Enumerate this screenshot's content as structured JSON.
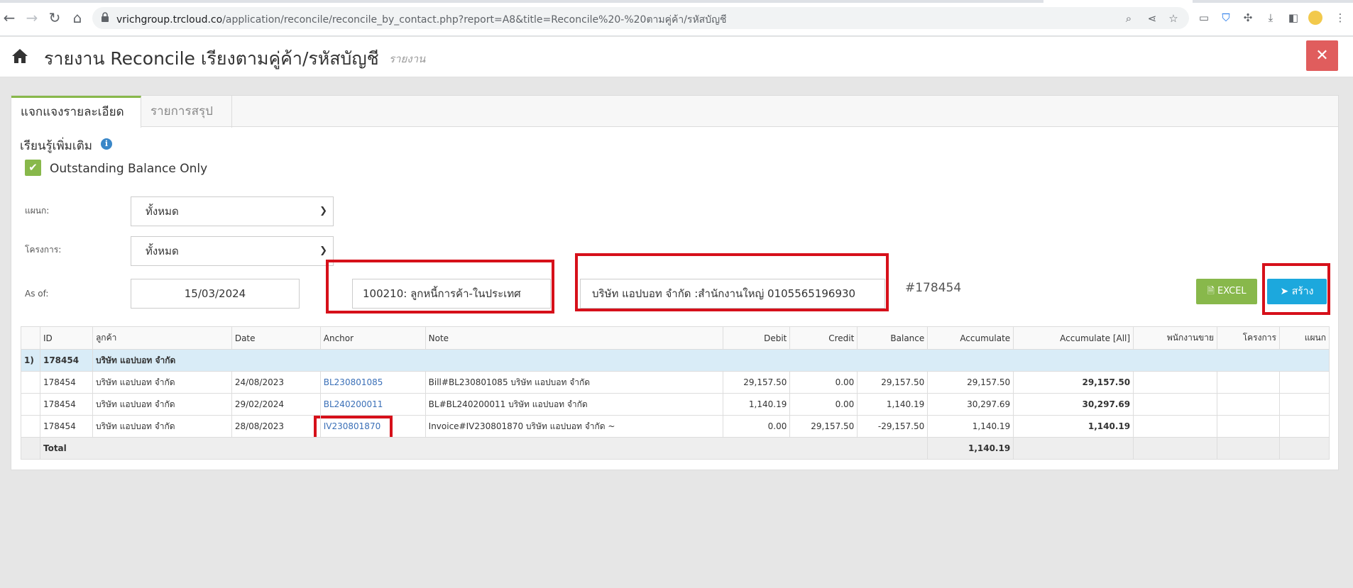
{
  "browser": {
    "url_host": "vrichgroup.trcloud.co",
    "url_path": "/application/reconcile/reconcile_by_contact.php?report=A8&title=Reconcile%20-%20ตามคู่ค้า/รหัสบัญชี"
  },
  "header": {
    "title": "รายงาน Reconcile เรียงตามคู่ค้า/รหัสบัญชี",
    "subtitle": "รายงาน",
    "close": "✕"
  },
  "tabs": [
    "แจกแจงรายละเอียด",
    "รายการสรุป"
  ],
  "learn_more": "เรียนรู้เพิ่มเติม",
  "outstanding": {
    "label": "Outstanding Balance Only",
    "checked": true
  },
  "filters": {
    "department_label": "แผนก:",
    "department_value": "ทั้งหมด",
    "project_label": "โครงการ:",
    "project_value": "ทั้งหมด",
    "asof_label": "As of:",
    "asof_value": "15/03/2024",
    "account_value": "100210: ลูกหนี้การค้า-ในประเทศ",
    "contact_value": "บริษัท แอปบอท จำกัด :สำนักงานใหญ่ 0105565196930",
    "ref": "#178454"
  },
  "buttons": {
    "excel": "EXCEL",
    "create": "สร้าง"
  },
  "table": {
    "headers": [
      "ID",
      "ลูกค้า",
      "Date",
      "Anchor",
      "Note",
      "Debit",
      "Credit",
      "Balance",
      "Accumulate",
      "Accumulate [All]",
      "พนักงานขาย",
      "โครงการ",
      "แผนก"
    ],
    "group": {
      "no": "1)",
      "id": "178454",
      "name": "บริษัท แอปบอท จำกัด"
    },
    "rows": [
      {
        "id": "178454",
        "customer": "บริษัท แอปบอท จำกัด",
        "date": "24/08/2023",
        "anchor": "BL230801085",
        "note": "Bill#BL230801085 บริษัท แอปบอท จำกัด",
        "debit": "29,157.50",
        "credit": "0.00",
        "balance": "29,157.50",
        "acc": "29,157.50",
        "acc_all": "29,157.50"
      },
      {
        "id": "178454",
        "customer": "บริษัท แอปบอท จำกัด",
        "date": "29/02/2024",
        "anchor": "BL240200011",
        "note": "BL#BL240200011 บริษัท แอปบอท จำกัด",
        "debit": "1,140.19",
        "credit": "0.00",
        "balance": "1,140.19",
        "acc": "30,297.69",
        "acc_all": "30,297.69"
      },
      {
        "id": "178454",
        "customer": "บริษัท แอปบอท จำกัด",
        "date": "28/08/2023",
        "anchor": "IV230801870",
        "note": "Invoice#IV230801870 บริษัท แอปบอท จำกัด ~",
        "debit": "0.00",
        "credit": "29,157.50",
        "balance": "-29,157.50",
        "acc": "1,140.19",
        "acc_all": "1,140.19"
      }
    ],
    "total_label": "Total",
    "total_value": "1,140.19"
  }
}
